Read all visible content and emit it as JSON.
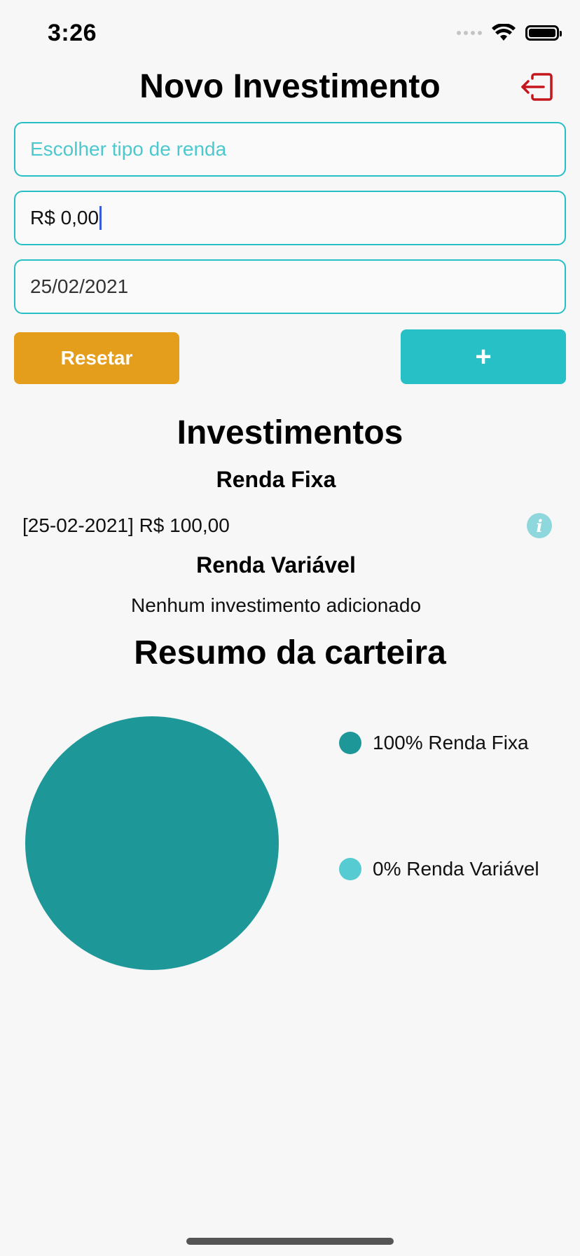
{
  "status_bar": {
    "time": "3:26",
    "icons": [
      "cellular-signal-icon",
      "wifi-icon",
      "battery-icon"
    ]
  },
  "header": {
    "title": "Novo Investimento",
    "logout_icon": "logout-icon",
    "logout_color": "#c4161c"
  },
  "form": {
    "type_placeholder": "Escolher tipo de renda",
    "amount_value": "R$ 0,00",
    "date_value": "25/02/2021",
    "reset_label": "Resetar",
    "add_label": "+"
  },
  "investments": {
    "title": "Investimentos",
    "fixed": {
      "title": "Renda Fixa",
      "items": [
        {
          "label": "[25-02-2021] R$ 100,00",
          "icon": "info-icon"
        }
      ]
    },
    "variable": {
      "title": "Renda Variável",
      "empty_text": "Nenhum investimento adicionado"
    }
  },
  "summary": {
    "title": "Resumo da carteira"
  },
  "chart_data": {
    "type": "pie",
    "title": "Resumo da carteira",
    "categories": [
      "Renda Fixa",
      "Renda Variável"
    ],
    "values": [
      100,
      0
    ],
    "labels": [
      "100% Renda Fixa",
      "0% Renda Variável"
    ],
    "colors": [
      "#1e9799",
      "#56ccd2"
    ],
    "legend_position": "right"
  },
  "colors": {
    "accent": "#26bfc6",
    "reset_button": "#e59e1c",
    "add_button": "#26c0c6",
    "background": "#f7f7f7"
  }
}
